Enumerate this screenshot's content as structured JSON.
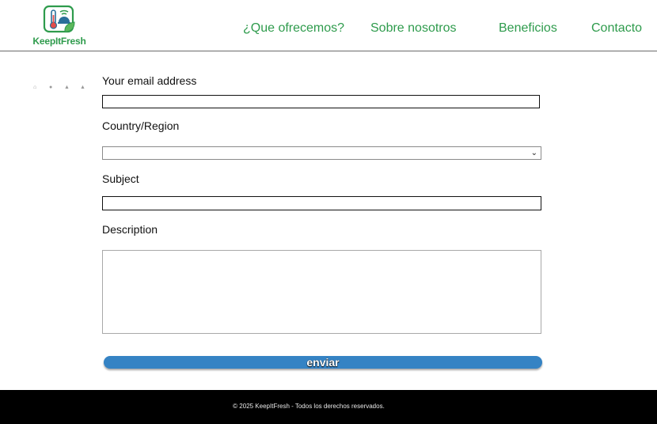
{
  "brand": {
    "name": "KeepItFresh",
    "colors": {
      "accent": "#2e9b4c",
      "button": "#3583c4",
      "footer_bg": "#000000"
    }
  },
  "nav": {
    "items": [
      {
        "label": "¿Que ofrecemos?"
      },
      {
        "label": "Sobre nosotros"
      },
      {
        "label": "Beneficios"
      },
      {
        "label": "Contacto"
      }
    ]
  },
  "social": {
    "icons": [
      "social-icon-1",
      "social-icon-2",
      "social-icon-3",
      "social-icon-4"
    ]
  },
  "form": {
    "email_label": "Your email address",
    "email_value": "",
    "country_label": "Country/Region",
    "country_value": "",
    "subject_label": "Subject",
    "subject_value": "",
    "description_label": "Description",
    "description_value": "",
    "submit_label": "enviar"
  },
  "footer": {
    "text": "© 2025 KeepItFresh - Todos los derechos reservados."
  }
}
